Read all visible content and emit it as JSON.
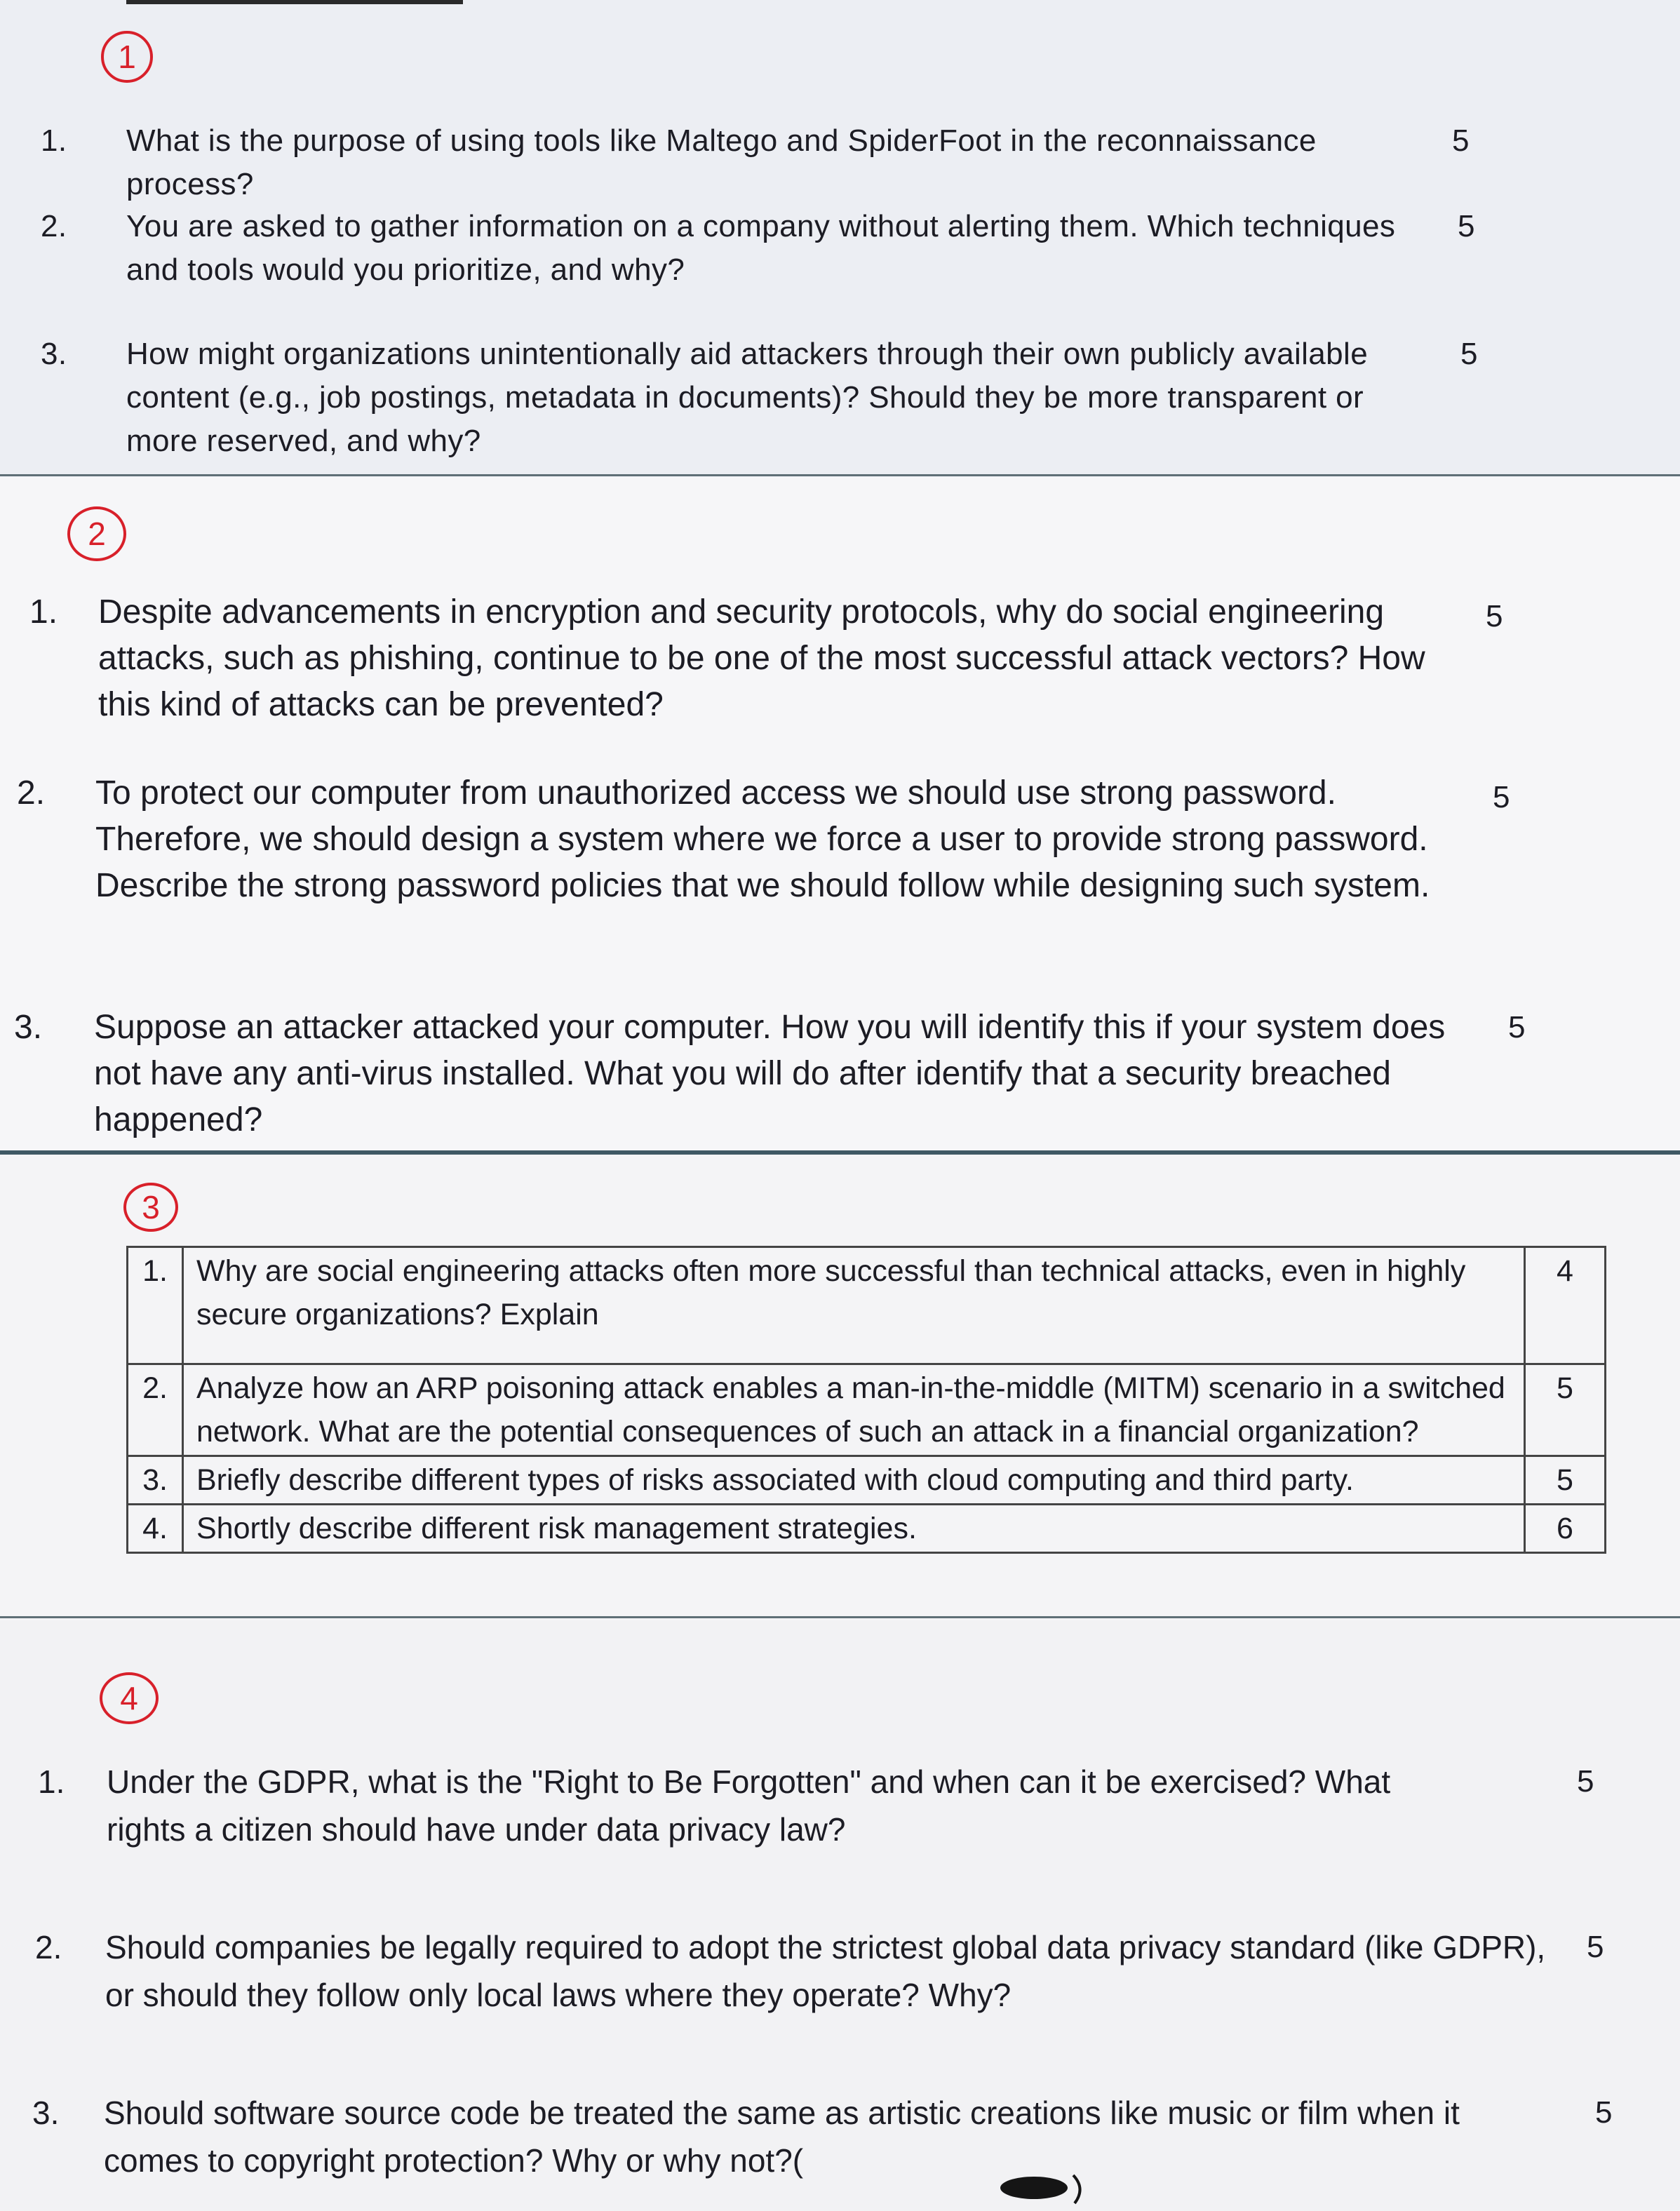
{
  "sections": [
    {
      "marker": "1",
      "questions": [
        {
          "num": "1.",
          "text": "What is the purpose of using tools like Maltego  and SpiderFoot in the reconnaissance process?",
          "marks": "5"
        },
        {
          "num": "2.",
          "text": "You are asked to gather information on a company without alerting them. Which techniques and tools would you prioritize, and why?",
          "marks": "5"
        },
        {
          "num": "3.",
          "text": "How might organizations unintentionally aid attackers through their own publicly available content (e.g., job postings, metadata in documents)? Should they be more transparent or more reserved, and why?",
          "marks": "5"
        }
      ]
    },
    {
      "marker": "2",
      "questions": [
        {
          "num": "1.",
          "text": "Despite advancements in encryption and security protocols, why do social engineering attacks, such as phishing, continue to be one of the most successful attack vectors? How this kind of attacks can be prevented?",
          "marks": "5"
        },
        {
          "num": "2.",
          "text": "To protect our computer from unauthorized access we should use strong password. Therefore, we should design a system where we force a user to provide strong password.  Describe the strong password policies that we should follow while designing  such system.",
          "marks": "5"
        },
        {
          "num": "3.",
          "text": "Suppose an attacker attacked your computer. How you will identify this if your system does not have any anti-virus installed. What you will do after identify that a security breached happened?",
          "marks": "5"
        }
      ]
    },
    {
      "marker": "3",
      "questions": [
        {
          "num": "1.",
          "text": "Why are social engineering attacks often more successful than technical attacks, even in highly secure organizations? Explain",
          "marks": "4"
        },
        {
          "num": "2.",
          "text": "Analyze how an ARP poisoning attack enables a man-in-the-middle (MITM) scenario in a switched network. What are the potential consequences of such an attack in a financial organization?",
          "marks": "5"
        },
        {
          "num": "3.",
          "text": "Briefly describe different types of risks associated with cloud computing and third party.",
          "marks": "5"
        },
        {
          "num": "4.",
          "text": "Shortly describe different risk management strategies.",
          "marks": "6"
        }
      ]
    },
    {
      "marker": "4",
      "questions": [
        {
          "num": "1.",
          "text": "Under the GDPR, what is the \"Right to Be Forgotten\" and when can it be exercised? What rights a citizen should have under data privacy law?",
          "marks": "5"
        },
        {
          "num": "2.",
          "text": "Should companies be legally required to adopt the strictest global data privacy standard (like GDPR), or should they follow only local laws where they operate? Why?",
          "marks": "5"
        },
        {
          "num": "3.",
          "text": "Should software source code be treated the same as artistic creations like music or film when it comes to copyright protection? Why or why not?(",
          "marks": "5"
        }
      ]
    }
  ],
  "colors": {
    "marker": "#d8202a",
    "ink": "#1c1c24",
    "rule": "#3f5864"
  }
}
